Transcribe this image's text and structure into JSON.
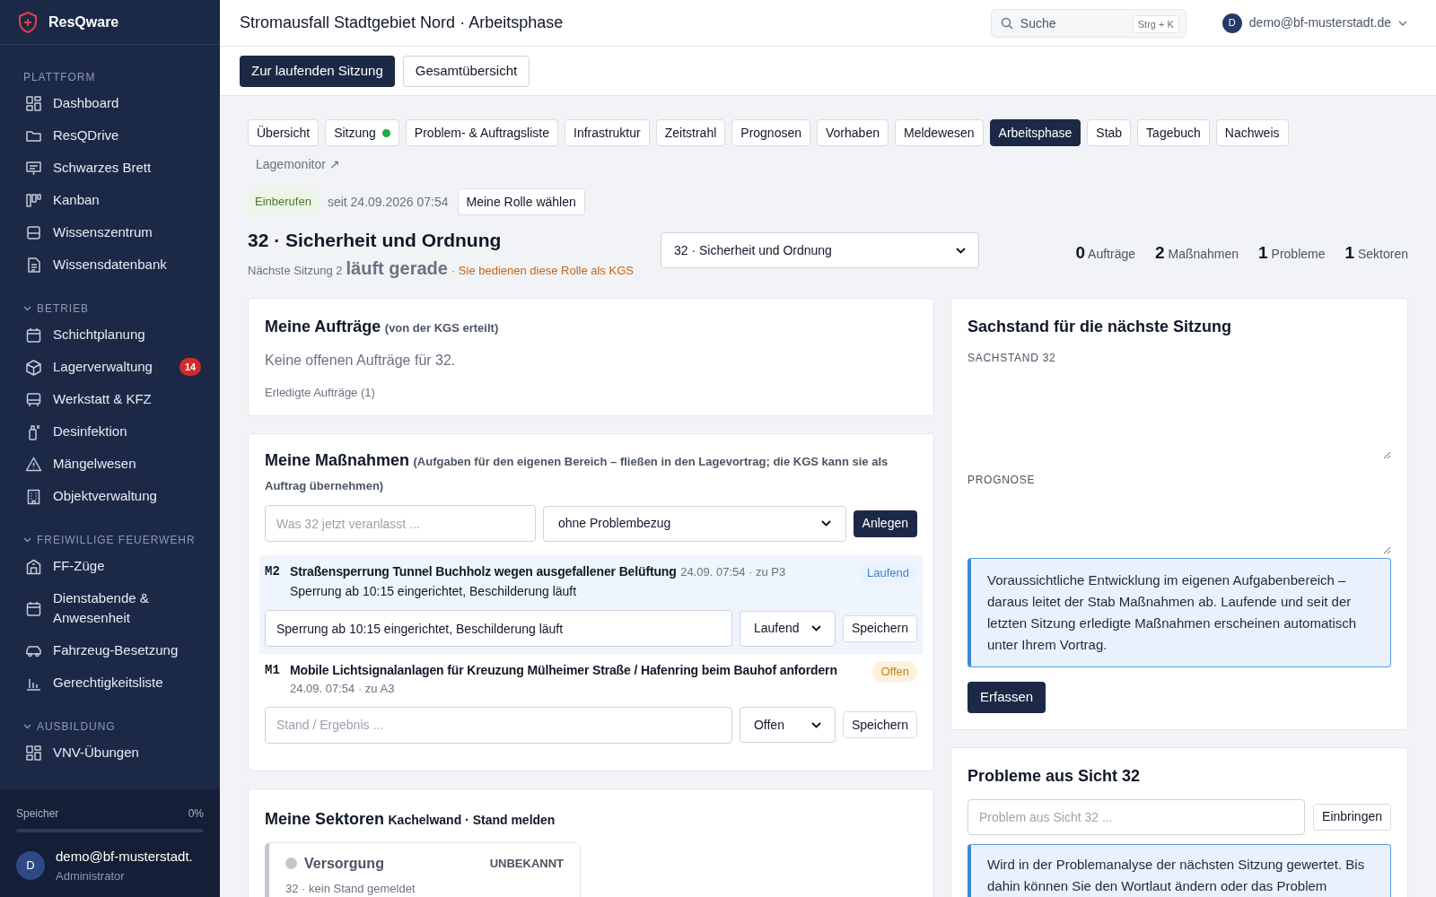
{
  "sidebar": {
    "logo": "ResQware",
    "sections": [
      {
        "title": "PLATTFORM",
        "collapsible": false,
        "items": [
          {
            "label": "Dashboard"
          },
          {
            "label": "ResQDrive"
          },
          {
            "label": "Schwarzes Brett"
          },
          {
            "label": "Kanban"
          },
          {
            "label": "Wissenszentrum"
          },
          {
            "label": "Wissensdatenbank"
          }
        ]
      },
      {
        "title": "BETRIEB",
        "collapsible": true,
        "items": [
          {
            "label": "Schichtplanung"
          },
          {
            "label": "Lagerverwaltung",
            "badge": "14"
          },
          {
            "label": "Werkstatt & KFZ"
          },
          {
            "label": "Desinfektion"
          },
          {
            "label": "Mängelwesen"
          },
          {
            "label": "Objektverwaltung"
          }
        ]
      },
      {
        "title": "FREIWILLIGE FEUERWEHR",
        "collapsible": true,
        "items": [
          {
            "label": "FF-Züge"
          },
          {
            "label": "Dienstabende & Anwesenheit"
          },
          {
            "label": "Fahrzeug-Besetzung"
          },
          {
            "label": "Gerechtigkeitsliste"
          }
        ]
      },
      {
        "title": "AUSBILDUNG",
        "collapsible": true,
        "items": [
          {
            "label": "VNV-Übungen"
          }
        ]
      }
    ],
    "storage": {
      "label": "Speicher",
      "value": "0%",
      "level": 0
    },
    "user": {
      "initial": "D",
      "email": "demo@bf-musterstadt.",
      "role": "Administrator"
    }
  },
  "header": {
    "title": "Stromausfall Stadtgebiet Nord · Arbeitsphase",
    "search": {
      "placeholder": "Suche",
      "shortcut": "Strg + K"
    },
    "user": {
      "initial": "D",
      "email": "demo@bf-musterstadt.de"
    }
  },
  "actions": [
    {
      "label": "Zur laufenden Sitzung",
      "primary": true
    },
    {
      "label": "Gesamtübersicht",
      "primary": false
    }
  ],
  "tabs": [
    {
      "label": "Übersicht",
      "selected": false,
      "kind": "tab",
      "dot": false
    },
    {
      "label": "Sitzung",
      "selected": false,
      "kind": "tab",
      "dot": true
    },
    {
      "label": "Problem- & Auftragsliste",
      "selected": false,
      "kind": "tab",
      "dot": false
    },
    {
      "label": "Infrastruktur",
      "selected": false,
      "kind": "tab",
      "dot": false
    },
    {
      "label": "Zeitstrahl",
      "selected": false,
      "kind": "tab",
      "dot": false
    },
    {
      "label": "Prognosen",
      "selected": false,
      "kind": "tab",
      "dot": false
    },
    {
      "label": "Vorhaben",
      "selected": false,
      "kind": "tab",
      "dot": false
    },
    {
      "label": "Meldewesen",
      "selected": false,
      "kind": "tab",
      "dot": false
    },
    {
      "label": "Arbeitsphase",
      "selected": true,
      "kind": "tab",
      "dot": false
    },
    {
      "label": "Stab",
      "selected": false,
      "kind": "tab",
      "dot": false
    },
    {
      "label": "Tagebuch",
      "selected": false,
      "kind": "tab",
      "dot": false
    },
    {
      "label": "Nachweis",
      "selected": false,
      "kind": "tab",
      "dot": false
    },
    {
      "label": "Lagemonitor ↗",
      "selected": false,
      "kind": "link",
      "dot": false
    }
  ],
  "session": {
    "status": "Einberufen",
    "since": "seit 24.09.2026 07:54",
    "role_button": "Meine Rolle wählen"
  },
  "role": {
    "title": "32 · Sicherheit und Ordnung",
    "next_label": "Nächste Sitzung 2",
    "next_state": "läuft gerade",
    "note": "· Sie bedienen diese Rolle als KGS",
    "select": "32 · Sicherheit und Ordnung",
    "stats": [
      "**0** Aufträge",
      "**2** Maßnahmen",
      "**1** Probleme",
      "**1** Sektoren"
    ]
  },
  "orders": {
    "title": "Meine Aufträge",
    "hint": "(von der KGS erteilt)",
    "empty": "Keine offenen Aufträge für 32.",
    "done": "Erledigte Aufträge (1)"
  },
  "measures": {
    "title": "Meine Maßnahmen",
    "hint": "(Aufgaben für den eigenen Bereich – fließen in den Lagevortrag; die KGS kann sie als Auftrag übernehmen)",
    "input_placeholder": "Was 32 jetzt veranlasst ...",
    "select": "ohne Problembezug",
    "button": "Anlegen",
    "items": [
      {
        "code": "M2",
        "title": "Straßensperrung Tunnel Buchholz wegen ausgefallener Belüftung",
        "meta": "24.09. 07:54 · zu P3",
        "note": "Sperrung ab 10:15 eingerichtet, Beschilderung läuft",
        "status": "Laufend",
        "kind": "running",
        "selected": true,
        "field_value": "Sperrung ab 10:15 eingerichtet, Beschilderung läuft",
        "select": "Laufend",
        "button": "Speichern"
      },
      {
        "code": "M1",
        "title": "Mobile Lichtsignalanlagen für Kreuzung Mülheimer Straße / Hafenring beim Bauhof anfordern",
        "meta": "24.09. 07:54 · zu A3",
        "status": "Offen",
        "kind": "open",
        "selected": false,
        "field_placeholder": "Stand / Ergebnis ...",
        "select": "Offen",
        "button": "Speichern"
      }
    ]
  },
  "sectors": {
    "title": "Meine Sektoren",
    "hint": "Kachelwand · Stand melden",
    "items": [
      {
        "name": "Versorgung",
        "status": "UNBEKANNT",
        "meta": "32 · kein Stand gemeldet",
        "color": "#c4c7cf"
      }
    ]
  },
  "situation": {
    "title": "Sachstand für die nächste Sitzung",
    "label_1": "SACHSTAND 32",
    "label_2": "PROGNOSE",
    "info": "Voraussichtliche Entwicklung im eigenen Aufgabenbereich – daraus leitet der Stab Maßnahmen ab. Laufende und seit der letzten Sitzung erledigte Maßnahmen erscheinen automatisch unter Ihrem Vortrag.",
    "button": "Erfassen"
  },
  "problems": {
    "title": "Probleme aus Sicht 32",
    "placeholder": "Problem aus Sicht 32 ...",
    "button": "Einbringen",
    "info": "Wird in der Problemanalyse der nächsten Sitzung gewertet. Bis dahin können Sie den Wortlaut ändern oder das Problem"
  }
}
